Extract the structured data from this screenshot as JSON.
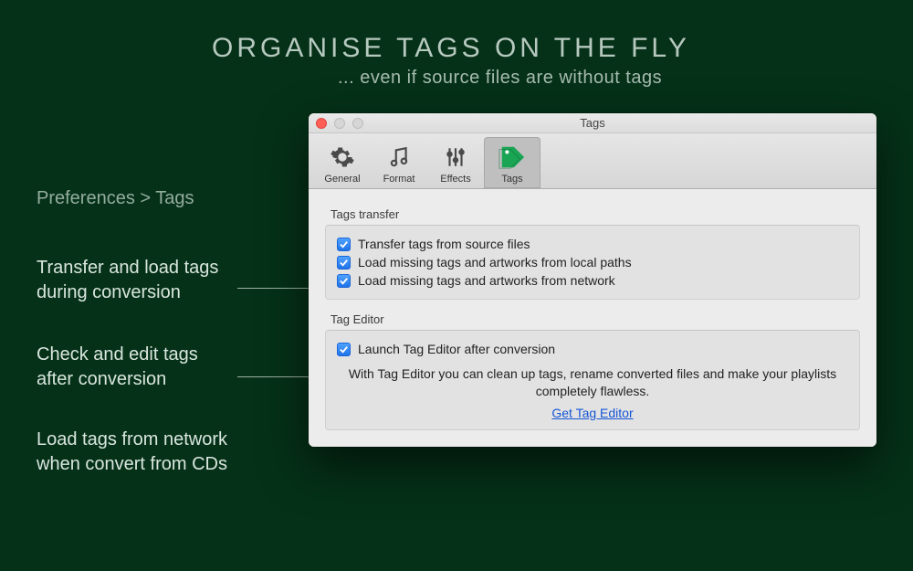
{
  "headline": "ORGANISE  TAGS  ON  THE  FLY",
  "subhead": "... even if source files are without tags",
  "breadcrumb": "Preferences > Tags",
  "annotations": {
    "a1_line1": "Transfer and load tags",
    "a1_line2": "during conversion",
    "a2_line1": "Check and edit tags",
    "a2_line2": "after conversion",
    "a3_line1": "Load tags from network",
    "a3_line2": "when convert from CDs"
  },
  "window": {
    "title": "Tags",
    "toolbar": {
      "general": "General",
      "format": "Format",
      "effects": "Effects",
      "tags": "Tags"
    },
    "section1": {
      "title": "Tags transfer",
      "opt1": "Transfer tags from source files",
      "opt2": "Load missing tags and artworks from local paths",
      "opt3": "Load missing tags and artworks from network"
    },
    "section2": {
      "title": "Tag Editor",
      "opt1": "Launch Tag Editor after conversion",
      "desc": "With Tag Editor you can clean up tags, rename converted files and make your playlists completely flawless.",
      "link": "Get Tag Editor"
    }
  }
}
